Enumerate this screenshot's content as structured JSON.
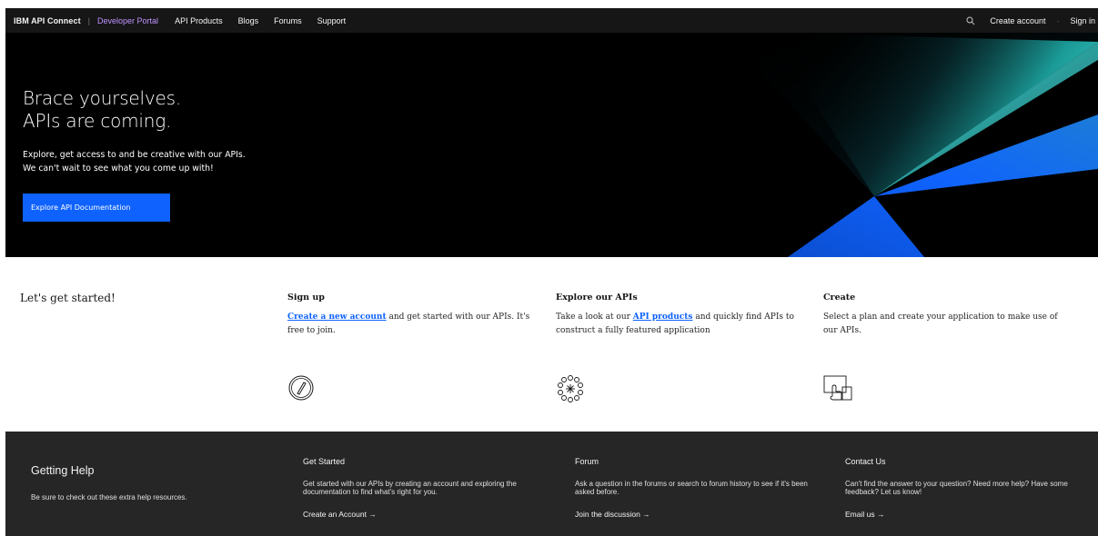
{
  "nav": {
    "brand": "IBM API Connect",
    "divider": "|",
    "portal": "Developer Portal",
    "links": [
      "API Products",
      "Blogs",
      "Forums",
      "Support"
    ],
    "create_account": "Create account",
    "dot": "·",
    "sign_in": "Sign in"
  },
  "hero": {
    "title_line1": "Brace yourselves.",
    "title_line2": "APIs are coming.",
    "sub_line1": "Explore, get access to and be creative with our APIs.",
    "sub_line2": "We can't wait to see what you come up with!",
    "cta": "Explore API Documentation"
  },
  "getting_started": {
    "title": "Let's get started!",
    "columns": [
      {
        "heading": "Sign up",
        "link": "Create a new account",
        "text": " and get started with our APIs. It's free to join."
      },
      {
        "heading": "Explore our APIs",
        "pre": "Take a look at our ",
        "link": "API products",
        "text": " and quickly find APIs to construct a fully featured application"
      },
      {
        "heading": "Create",
        "text": "Select a plan and create your application to make use of our APIs."
      }
    ]
  },
  "footer": {
    "title": "Getting Help",
    "subtitle": "Be sure to check out these extra help resources.",
    "columns": [
      {
        "heading": "Get Started",
        "text": "Get started with our APIs by creating an account and exploring the documentation to find what's right for you.",
        "link": "Create an Account →"
      },
      {
        "heading": "Forum",
        "text": "Ask a question in the forums or search to forum history to see if it's been asked before.",
        "link": "Join the discussion →"
      },
      {
        "heading": "Contact Us",
        "text": "Can't find the answer to your question? Need more help? Have some feedback? Let us know!",
        "link": "Email us →"
      }
    ]
  },
  "colors": {
    "nav_bg": "#161616",
    "accent_purple": "#be95ff",
    "primary_blue": "#0f62fe",
    "footer_bg": "#262626"
  },
  "icons": [
    "search-icon",
    "pencil-icon",
    "network-icon",
    "touch-icon"
  ]
}
